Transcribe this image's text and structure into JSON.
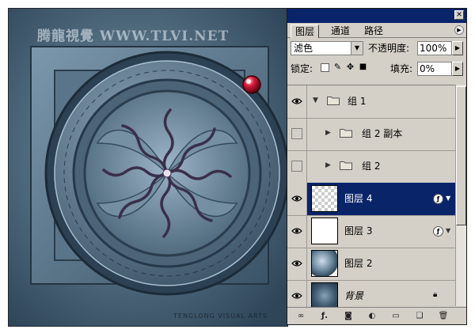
{
  "artwork": {
    "watermark": "腾龍視覺 WWW.TLVI.NET",
    "footer_text": "TENGLONG VISUAL ARTS"
  },
  "panel": {
    "tabs": [
      {
        "label": "图层",
        "active": true
      },
      {
        "label": "通道",
        "active": false
      },
      {
        "label": "路径",
        "active": false
      }
    ],
    "blend_mode": "滤色",
    "opacity_label": "不透明度:",
    "opacity_value": "100%",
    "lock_label": "锁定:",
    "fill_label": "填充:",
    "fill_value": "0%",
    "layers": [
      {
        "name": "组 1",
        "type": "group",
        "visible": true,
        "expanded": true
      },
      {
        "name": "组 2 副本",
        "type": "group",
        "visible": false,
        "expanded": false
      },
      {
        "name": "组 2",
        "type": "group",
        "visible": false,
        "expanded": false
      },
      {
        "name": "图层 4",
        "type": "layer",
        "visible": true,
        "selected": true,
        "fx": true
      },
      {
        "name": "图层 3",
        "type": "layer",
        "visible": true,
        "fx": true
      },
      {
        "name": "图层 2",
        "type": "layer",
        "visible": true
      },
      {
        "name": "背景",
        "type": "background",
        "visible": true,
        "locked": true
      }
    ],
    "bottom_icons": [
      "link-icon",
      "fx-icon",
      "mask-icon",
      "adjustment-icon",
      "new-group-icon",
      "new-layer-icon",
      "trash-icon"
    ]
  },
  "colors": {
    "titlebar": "#0a246a",
    "selection": "#0a246a",
    "panel_bg": "#d4d0c8",
    "artwork_bg": "#4d6a80"
  }
}
